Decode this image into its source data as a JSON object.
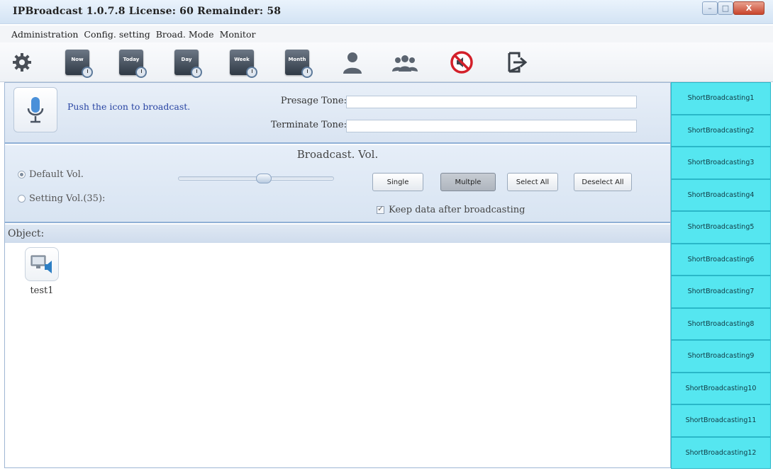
{
  "window": {
    "title": "IPBroadcast 1.0.7.8 License: 60 Remainder: 58",
    "controls": [
      "–",
      "□",
      "X"
    ]
  },
  "menu": [
    "Administration",
    "Config. setting",
    "Broad. Mode",
    "Monitor"
  ],
  "toolbar": {
    "items": [
      {
        "name": "settings-icon"
      },
      {
        "name": "calendar-now-icon",
        "label": "Now"
      },
      {
        "name": "calendar-today-icon",
        "label": "Today"
      },
      {
        "name": "calendar-day-icon",
        "label": "Day"
      },
      {
        "name": "calendar-week-icon",
        "label": "Week"
      },
      {
        "name": "calendar-month-icon",
        "label": "Month"
      },
      {
        "name": "user-icon"
      },
      {
        "name": "group-icon"
      },
      {
        "name": "mute-icon"
      },
      {
        "name": "exit-icon"
      }
    ]
  },
  "broadcast": {
    "push_text": "Push the icon to broadcast.",
    "presage_label": "Presage Tone:",
    "presage_value": "",
    "terminate_label": "Terminate Tone:",
    "terminate_value": ""
  },
  "volume": {
    "title": "Broadcast. Vol.",
    "default_label": "Default Vol.",
    "setting_label": "Setting Vol.(35):",
    "default_selected": true,
    "slider_value_fraction": 0.55,
    "buttons": {
      "single": "Single",
      "multiple": "Multple",
      "select_all": "Select All",
      "deselect_all": "Deselect All"
    },
    "keep_data_label": "Keep data after broadcasting",
    "keep_data_checked": true
  },
  "objects": {
    "header": "Object:",
    "items": [
      {
        "label": "test1"
      }
    ]
  },
  "short_broadcasts": [
    "ShortBroadcasting1",
    "ShortBroadcasting2",
    "ShortBroadcasting3",
    "ShortBroadcasting4",
    "ShortBroadcasting5",
    "ShortBroadcasting6",
    "ShortBroadcasting7",
    "ShortBroadcasting8",
    "ShortBroadcasting9",
    "ShortBroadcasting10",
    "ShortBroadcasting11",
    "ShortBroadcasting12"
  ],
  "colors": {
    "accent_cyan": "#55e6f0",
    "push_text": "#2945a3"
  }
}
